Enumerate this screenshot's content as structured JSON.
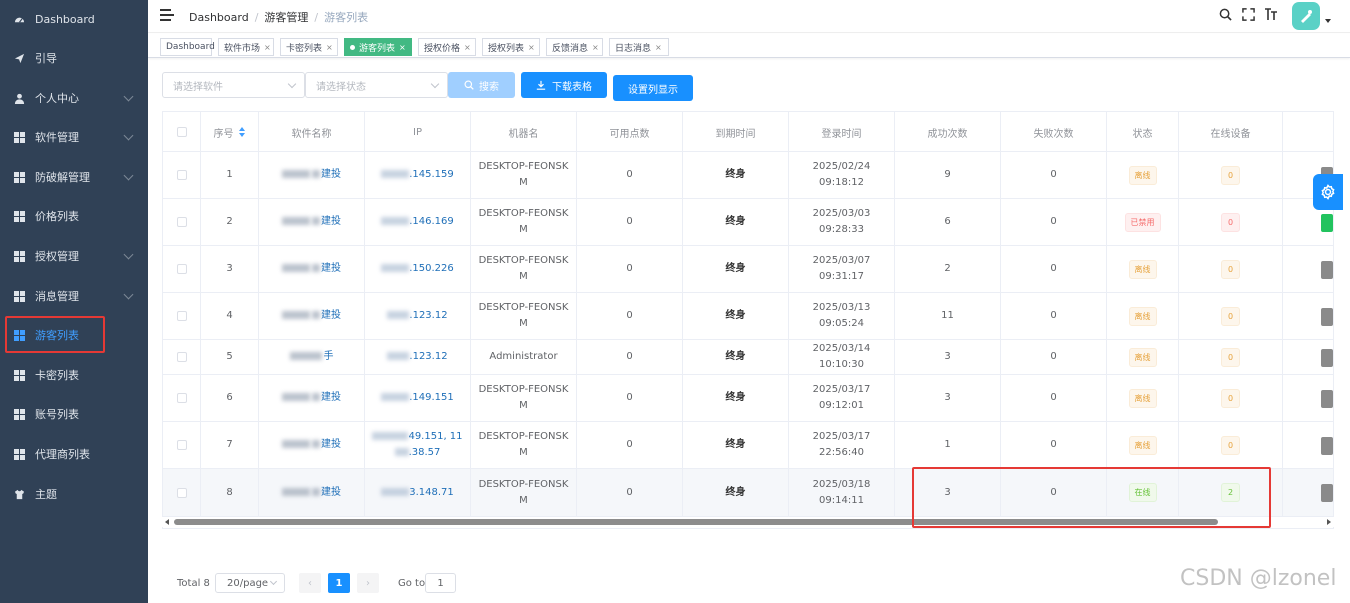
{
  "sidebar": {
    "items": [
      {
        "label": "Dashboard",
        "icon": "dashboard-icon",
        "has_children": false
      },
      {
        "label": "引导",
        "icon": "send-icon",
        "has_children": false
      },
      {
        "label": "个人中心",
        "icon": "user-icon",
        "has_children": true
      },
      {
        "label": "软件管理",
        "icon": "grid-icon",
        "has_children": true
      },
      {
        "label": "防破解管理",
        "icon": "grid-icon",
        "has_children": true
      },
      {
        "label": "价格列表",
        "icon": "grid-icon",
        "has_children": false
      },
      {
        "label": "授权管理",
        "icon": "grid-icon",
        "has_children": true
      },
      {
        "label": "消息管理",
        "icon": "grid-icon",
        "has_children": true
      },
      {
        "label": "游客列表",
        "icon": "grid-icon",
        "has_children": false,
        "active": true
      },
      {
        "label": "卡密列表",
        "icon": "grid-icon",
        "has_children": false
      },
      {
        "label": "账号列表",
        "icon": "grid-icon",
        "has_children": false
      },
      {
        "label": "代理商列表",
        "icon": "grid-icon",
        "has_children": false
      },
      {
        "label": "主题",
        "icon": "shirt-icon",
        "has_children": false
      }
    ]
  },
  "header": {
    "breadcrumb": [
      "Dashboard",
      "游客管理",
      "游客列表"
    ]
  },
  "tags": [
    {
      "label": "Dashboard",
      "closable": false
    },
    {
      "label": "软件市场",
      "closable": true
    },
    {
      "label": "卡密列表",
      "closable": true
    },
    {
      "label": "游客列表",
      "closable": true,
      "active": true
    },
    {
      "label": "授权价格",
      "closable": true
    },
    {
      "label": "授权列表",
      "closable": true
    },
    {
      "label": "反馈消息",
      "closable": true
    },
    {
      "label": "日志消息",
      "closable": true
    }
  ],
  "filters": {
    "software_placeholder": "请选择软件",
    "status_placeholder": "请选择状态",
    "search_label": "搜索",
    "download_label": "下载表格",
    "columns_label": "设置列显示"
  },
  "table": {
    "columns": [
      "序号",
      "软件名称",
      "IP",
      "机器名",
      "可用点数",
      "到期时间",
      "登录时间",
      "成功次数",
      "失败次数",
      "状态",
      "在线设备"
    ],
    "rows": [
      {
        "no": "1",
        "software_suffix": "建投",
        "ip_suffix": ".145.159",
        "machine": "DESKTOP-FEONSKM",
        "points": "0",
        "expire": "终身",
        "login": "2025/02/24 09:18:12",
        "success": "9",
        "fail": "0",
        "status": "离线",
        "status_type": "warning",
        "online": "0",
        "online_type": "warning"
      },
      {
        "no": "2",
        "software_suffix": "建投",
        "ip_suffix": ".146.169",
        "machine": "DESKTOP-FEONSKM",
        "points": "0",
        "expire": "终身",
        "login": "2025/03/03 09:28:33",
        "success": "6",
        "fail": "0",
        "status": "已禁用",
        "status_type": "danger",
        "online": "0",
        "online_type": "danger"
      },
      {
        "no": "3",
        "software_suffix": "建投",
        "ip_suffix": ".150.226",
        "machine": "DESKTOP-FEONSKM",
        "points": "0",
        "expire": "终身",
        "login": "2025/03/07 09:31:17",
        "success": "2",
        "fail": "0",
        "status": "离线",
        "status_type": "warning",
        "online": "0",
        "online_type": "warning"
      },
      {
        "no": "4",
        "software_suffix": "建投",
        "ip_suffix": ".123.12",
        "machine": "DESKTOP-FEONSKM",
        "points": "0",
        "expire": "终身",
        "login": "2025/03/13 09:05:24",
        "success": "11",
        "fail": "0",
        "status": "离线",
        "status_type": "warning",
        "online": "0",
        "online_type": "warning"
      },
      {
        "no": "5",
        "software_suffix": "手",
        "ip_suffix": ".123.12",
        "machine": "Administrator",
        "points": "0",
        "expire": "终身",
        "login": "2025/03/14 10:10:30",
        "success": "3",
        "fail": "0",
        "status": "离线",
        "status_type": "warning",
        "online": "0",
        "online_type": "warning"
      },
      {
        "no": "6",
        "software_suffix": "建投",
        "ip_suffix": ".149.151",
        "machine": "DESKTOP-FEONSKM",
        "points": "0",
        "expire": "终身",
        "login": "2025/03/17 09:12:01",
        "success": "3",
        "fail": "0",
        "status": "离线",
        "status_type": "warning",
        "online": "0",
        "online_type": "warning"
      },
      {
        "no": "7",
        "software_suffix": "建投",
        "ip_suffix": "49.151, 11",
        "ip_suffix2": ".38.57",
        "machine": "DESKTOP-FEONSKM",
        "points": "0",
        "expire": "终身",
        "login": "2025/03/17 22:56:40",
        "success": "1",
        "fail": "0",
        "status": "离线",
        "status_type": "warning",
        "online": "0",
        "online_type": "warning"
      },
      {
        "no": "8",
        "software_suffix": "建投",
        "ip_suffix": "3.148.71",
        "machine": "DESKTOP-FEONSKM",
        "points": "0",
        "expire": "终身",
        "login": "2025/03/18 09:14:11",
        "success": "3",
        "fail": "0",
        "status": "在线",
        "status_type": "success",
        "online": "2",
        "online_type": "success"
      }
    ]
  },
  "pagination": {
    "total": "Total 8",
    "page_size": "20/page",
    "current_page": "1",
    "goto_label": "Go to",
    "goto_value": "1"
  },
  "watermark": "CSDN @lzonel",
  "colors": {
    "sidebar_bg": "#304156",
    "primary": "#1890ff",
    "tag_active": "#42b983",
    "highlight_box": "#e53935"
  }
}
